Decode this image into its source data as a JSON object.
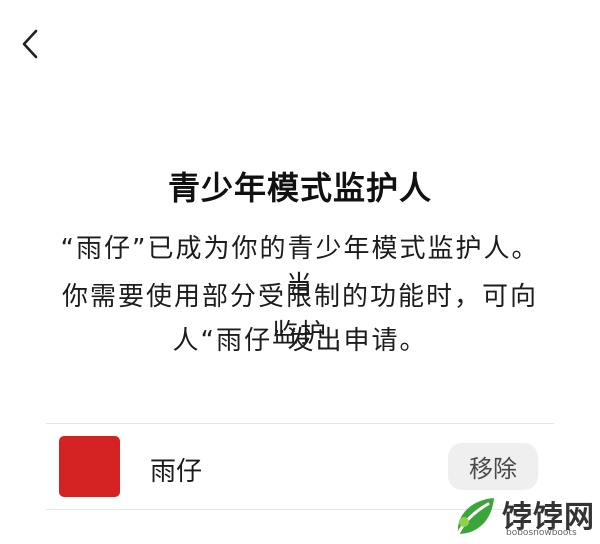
{
  "header": {
    "back_icon": "chevron-left-icon"
  },
  "main": {
    "title": "青少年模式监护人",
    "description_lines": [
      "“雨仔”已成为你的青少年模式监护人。当",
      "你需要使用部分受限制的功能时，可向监护",
      "人“雨仔”发出申请。"
    ]
  },
  "guardian": {
    "avatar_color": "#d42222",
    "name": "雨仔",
    "remove_label": "移除"
  },
  "watermark": {
    "brand": "饽饽网",
    "domain": "bobosnowboots"
  }
}
